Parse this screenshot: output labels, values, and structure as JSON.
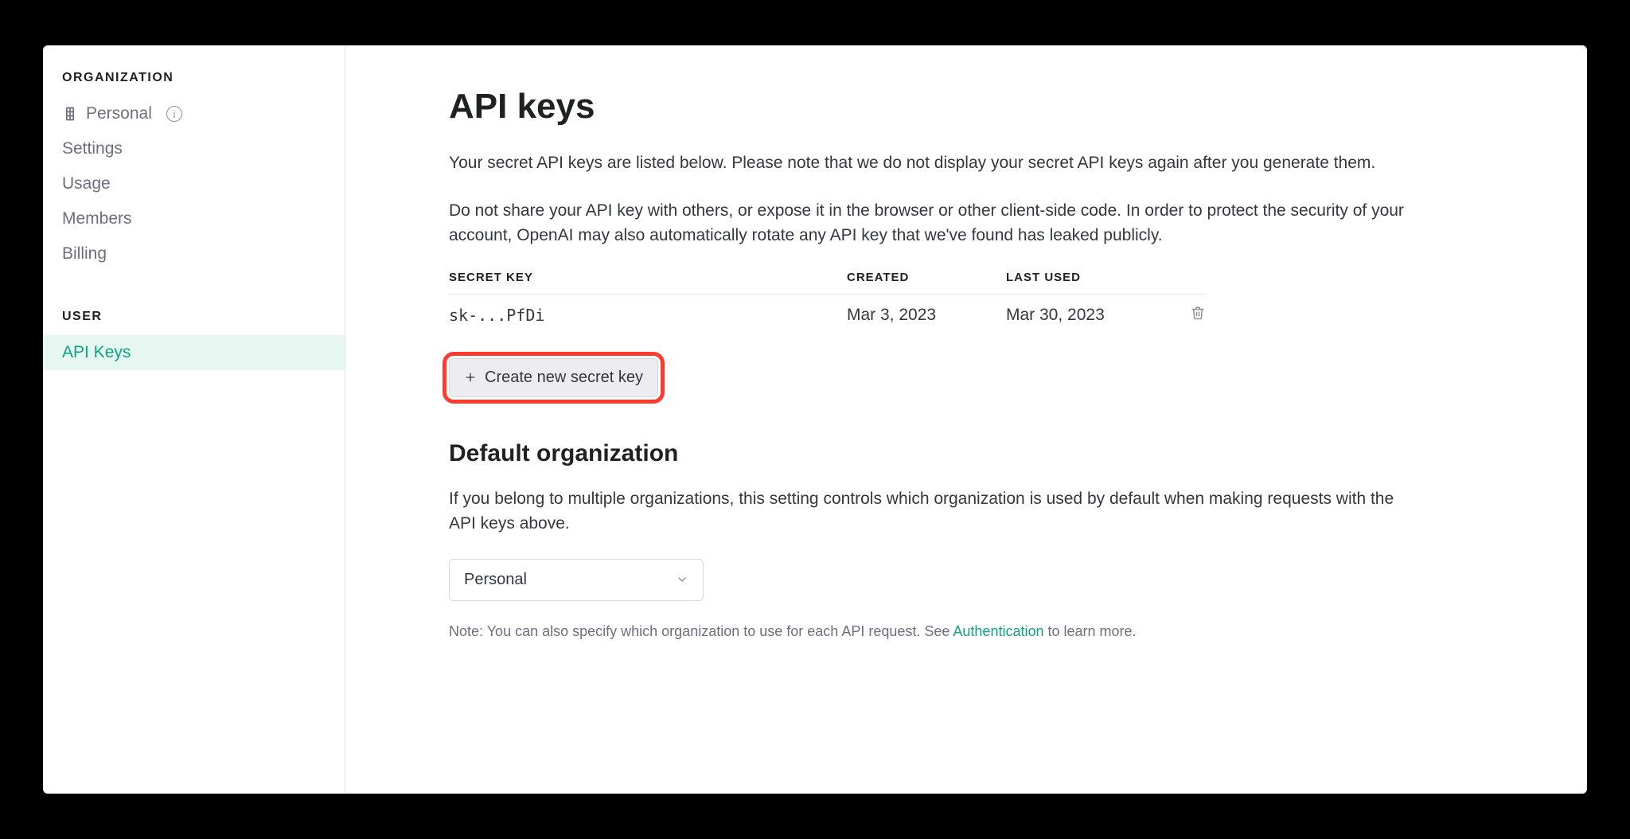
{
  "sidebar": {
    "org_heading": "ORGANIZATION",
    "org_name": "Personal",
    "items": [
      {
        "label": "Settings"
      },
      {
        "label": "Usage"
      },
      {
        "label": "Members"
      },
      {
        "label": "Billing"
      }
    ],
    "user_heading": "USER",
    "user_items": [
      {
        "label": "API Keys"
      }
    ]
  },
  "main": {
    "title": "API keys",
    "intro1": "Your secret API keys are listed below. Please note that we do not display your secret API keys again after you generate them.",
    "intro2": "Do not share your API key with others, or expose it in the browser or other client-side code. In order to protect the security of your account, OpenAI may also automatically rotate any API key that we've found has leaked publicly.",
    "table": {
      "headers": {
        "key": "SECRET KEY",
        "created": "CREATED",
        "used": "LAST USED"
      },
      "rows": [
        {
          "key": "sk-...PfDi",
          "created": "Mar 3, 2023",
          "used": "Mar 30, 2023"
        }
      ]
    },
    "create_label": "Create new secret key",
    "default_org": {
      "heading": "Default organization",
      "desc": "If you belong to multiple organizations, this setting controls which organization is used by default when making requests with the API keys above.",
      "selected": "Personal",
      "note_prefix": "Note: You can also specify which organization to use for each API request. See ",
      "note_link": "Authentication",
      "note_suffix": " to learn more."
    }
  }
}
